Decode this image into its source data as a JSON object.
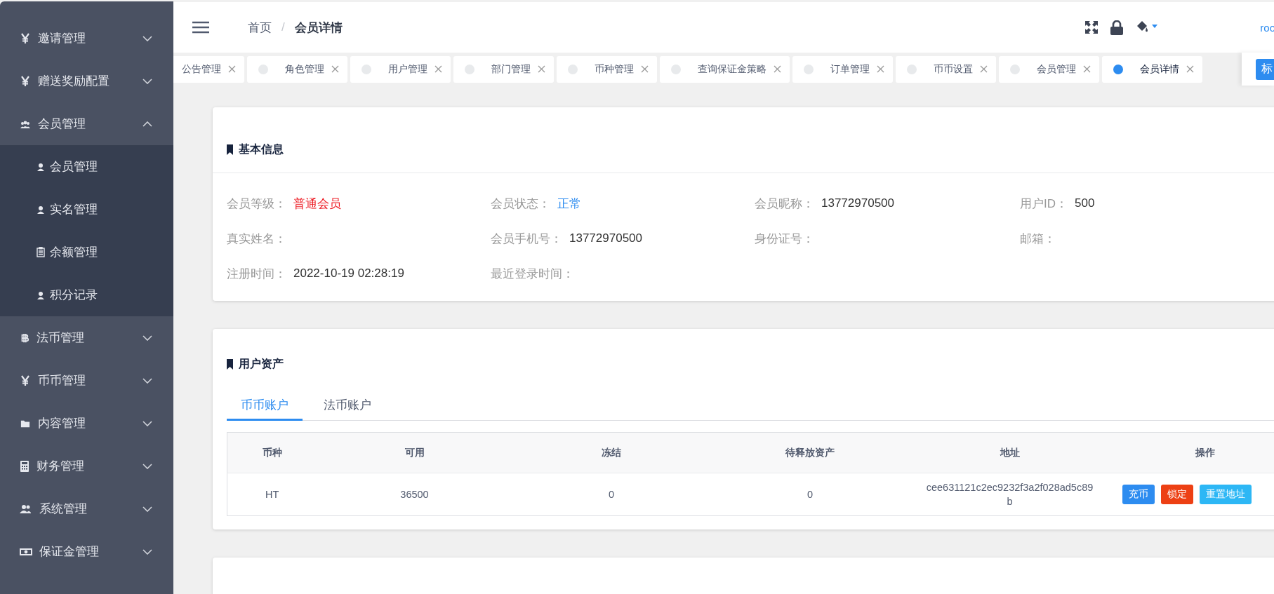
{
  "sidebar": {
    "items": [
      {
        "label": "邀请管理",
        "expanded": false
      },
      {
        "label": "赠送奖励配置",
        "expanded": false
      },
      {
        "label": "会员管理",
        "expanded": true,
        "children": [
          {
            "label": "会员管理"
          },
          {
            "label": "实名管理"
          },
          {
            "label": "余额管理"
          },
          {
            "label": "积分记录"
          }
        ]
      },
      {
        "label": "法币管理",
        "expanded": false
      },
      {
        "label": "币币管理",
        "expanded": false
      },
      {
        "label": "内容管理",
        "expanded": false
      },
      {
        "label": "财务管理",
        "expanded": false
      },
      {
        "label": "系统管理",
        "expanded": false
      },
      {
        "label": "保证金管理",
        "expanded": false
      }
    ]
  },
  "header": {
    "breadcrumb": [
      "首页",
      "会员详情"
    ],
    "separator": "/",
    "user": "roo"
  },
  "tabs": [
    {
      "label": "公告管理",
      "selected": false
    },
    {
      "label": "角色管理",
      "selected": false
    },
    {
      "label": "用户管理",
      "selected": false
    },
    {
      "label": "部门管理",
      "selected": false
    },
    {
      "label": "币种管理",
      "selected": false
    },
    {
      "label": "查询保证金策略",
      "selected": false
    },
    {
      "label": "订单管理",
      "selected": false
    },
    {
      "label": "币币设置",
      "selected": false
    },
    {
      "label": "会员管理",
      "selected": false
    },
    {
      "label": "会员详情",
      "selected": true
    }
  ],
  "tab_tools": {
    "label": "标"
  },
  "basic_info": {
    "title": "基本信息",
    "fields": [
      {
        "label": "会员等级：",
        "value": "普通会员",
        "color": "#ed1c24"
      },
      {
        "label": "会员状态：",
        "value": "正常",
        "color": "#2d8cf0"
      },
      {
        "label": "会员昵称：",
        "value": "13772970500"
      },
      {
        "label": "用户ID：",
        "value": "500"
      },
      {
        "label": "真实姓名："
      },
      {
        "label": "会员手机号：",
        "value": "13772970500"
      },
      {
        "label": "身份证号："
      },
      {
        "label": "邮箱："
      },
      {
        "label": "注册时间：",
        "value": "2022-10-19 02:28:19"
      },
      {
        "label": "最近登录时间："
      }
    ]
  },
  "assets": {
    "title": "用户资产",
    "tabs": [
      {
        "label": "币币账户",
        "selected": true
      },
      {
        "label": "法币账户",
        "selected": false
      }
    ],
    "table": {
      "columns": [
        "币种",
        "可用",
        "冻结",
        "待释放资产",
        "地址",
        "操作"
      ],
      "rows": [
        {
          "cells": [
            "HT",
            "36500",
            "0",
            "0",
            "cee631121c2ec9232f3a2f028ad5c89b"
          ],
          "actions": [
            {
              "label": "充币",
              "kind": "primary"
            },
            {
              "label": "锁定",
              "kind": "error"
            },
            {
              "label": "重置地址",
              "kind": "info"
            }
          ]
        }
      ]
    }
  }
}
